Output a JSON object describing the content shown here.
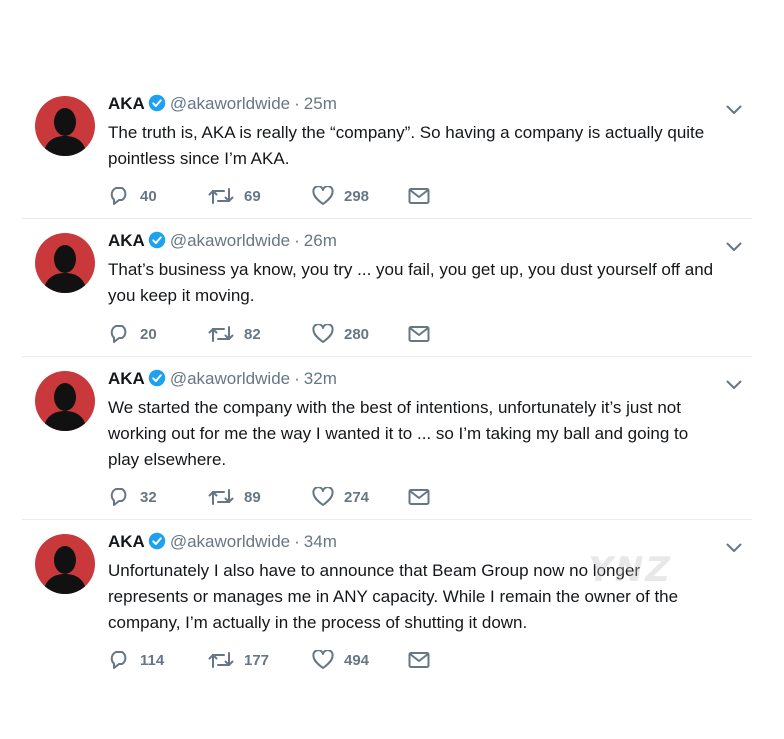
{
  "colors": {
    "avatar_bg": "#c9393c",
    "verified": "#1da1f2",
    "muted": "#657786",
    "text": "#14171a"
  },
  "icons": {
    "reply": "reply-icon",
    "retweet": "retweet-icon",
    "like": "heart-icon",
    "dm": "envelope-icon",
    "menu": "chevron-down-icon",
    "verified": "verified-badge-icon"
  },
  "tweets": [
    {
      "name": "AKA",
      "handle": "@akaworldwide",
      "separator": "·",
      "time": "25m",
      "lines": [
        "The truth is, AKA is really the “company”. So having a company is actually quite",
        "pointless since I’m AKA."
      ],
      "replies": "40",
      "retweets": "69",
      "likes": "298"
    },
    {
      "name": "AKA",
      "handle": "@akaworldwide",
      "separator": "·",
      "time": "26m",
      "lines": [
        "That’s business ya know, you try ... you fail, you get up, you dust yourself off and",
        "you keep it moving."
      ],
      "replies": "20",
      "retweets": "82",
      "likes": "280"
    },
    {
      "name": "AKA",
      "handle": "@akaworldwide",
      "separator": "·",
      "time": "32m",
      "lines": [
        "We started the company with the best of intentions, unfortunately it’s just not",
        "working out for me the way I wanted it to ... so I’m taking my ball and going to",
        "play elsewhere."
      ],
      "replies": "32",
      "retweets": "89",
      "likes": "274"
    },
    {
      "name": "AKA",
      "handle": "@akaworldwide",
      "separator": "·",
      "time": "34m",
      "lines": [
        "Unfortunately I also have to announce that Beam Group now no longer",
        "represents or manages me in ANY capacity. While I remain the owner of the",
        "company, I’m actually in the process of shutting it down."
      ],
      "replies": "114",
      "retweets": "177",
      "likes": "494"
    }
  ],
  "watermark": "YNZ"
}
